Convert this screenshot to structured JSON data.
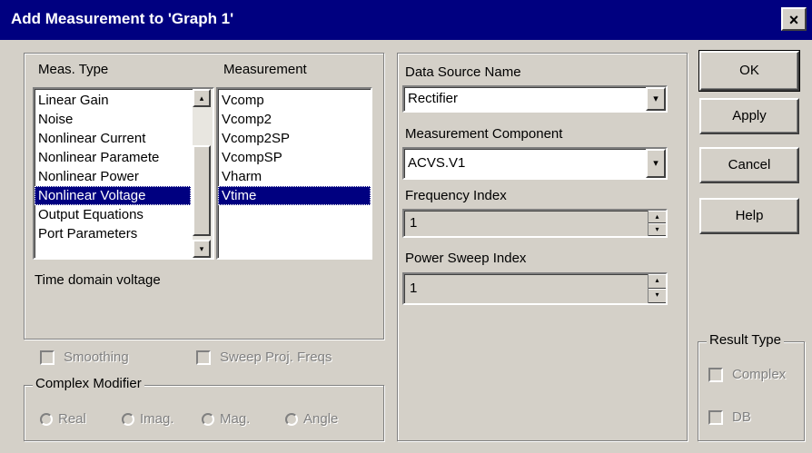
{
  "window": {
    "title": "Add Measurement to 'Graph 1'",
    "close_glyph": "×"
  },
  "meas_type": {
    "header": "Meas. Type",
    "items": [
      "Linear Gain",
      "Noise",
      "Nonlinear Current",
      "Nonlinear Paramete",
      "Nonlinear Power",
      "Nonlinear Voltage",
      "Output Equations",
      "Port Parameters"
    ],
    "selected": "Nonlinear Voltage"
  },
  "measurement": {
    "header": "Measurement",
    "items": [
      "Vcomp",
      "Vcomp2",
      "Vcomp2SP",
      "VcompSP",
      "Vharm",
      "Vtime"
    ],
    "selected": "Vtime"
  },
  "description": "Time domain voltage",
  "options": {
    "smoothing": "Smoothing",
    "sweep_proj": "Sweep Proj. Freqs"
  },
  "complex_modifier": {
    "title": "Complex Modifier",
    "options": [
      "Real",
      "Imag.",
      "Mag.",
      "Angle"
    ]
  },
  "fields": {
    "data_source_label": "Data Source Name",
    "data_source_value": "Rectifier",
    "component_label": "Measurement Component",
    "component_value": "ACVS.V1",
    "freq_index_label": "Frequency Index",
    "freq_index_value": "1",
    "power_sweep_label": "Power Sweep Index",
    "power_sweep_value": "1"
  },
  "buttons": {
    "ok": "OK",
    "apply": "Apply",
    "cancel": "Cancel",
    "help": "Help"
  },
  "result_type": {
    "title": "Result Type",
    "complex": "Complex",
    "db": "DB"
  },
  "icons": {
    "dropdown": "▾",
    "spin_up": "▴",
    "spin_down": "▾",
    "scroll_up": "▴",
    "scroll_down": "▾"
  }
}
